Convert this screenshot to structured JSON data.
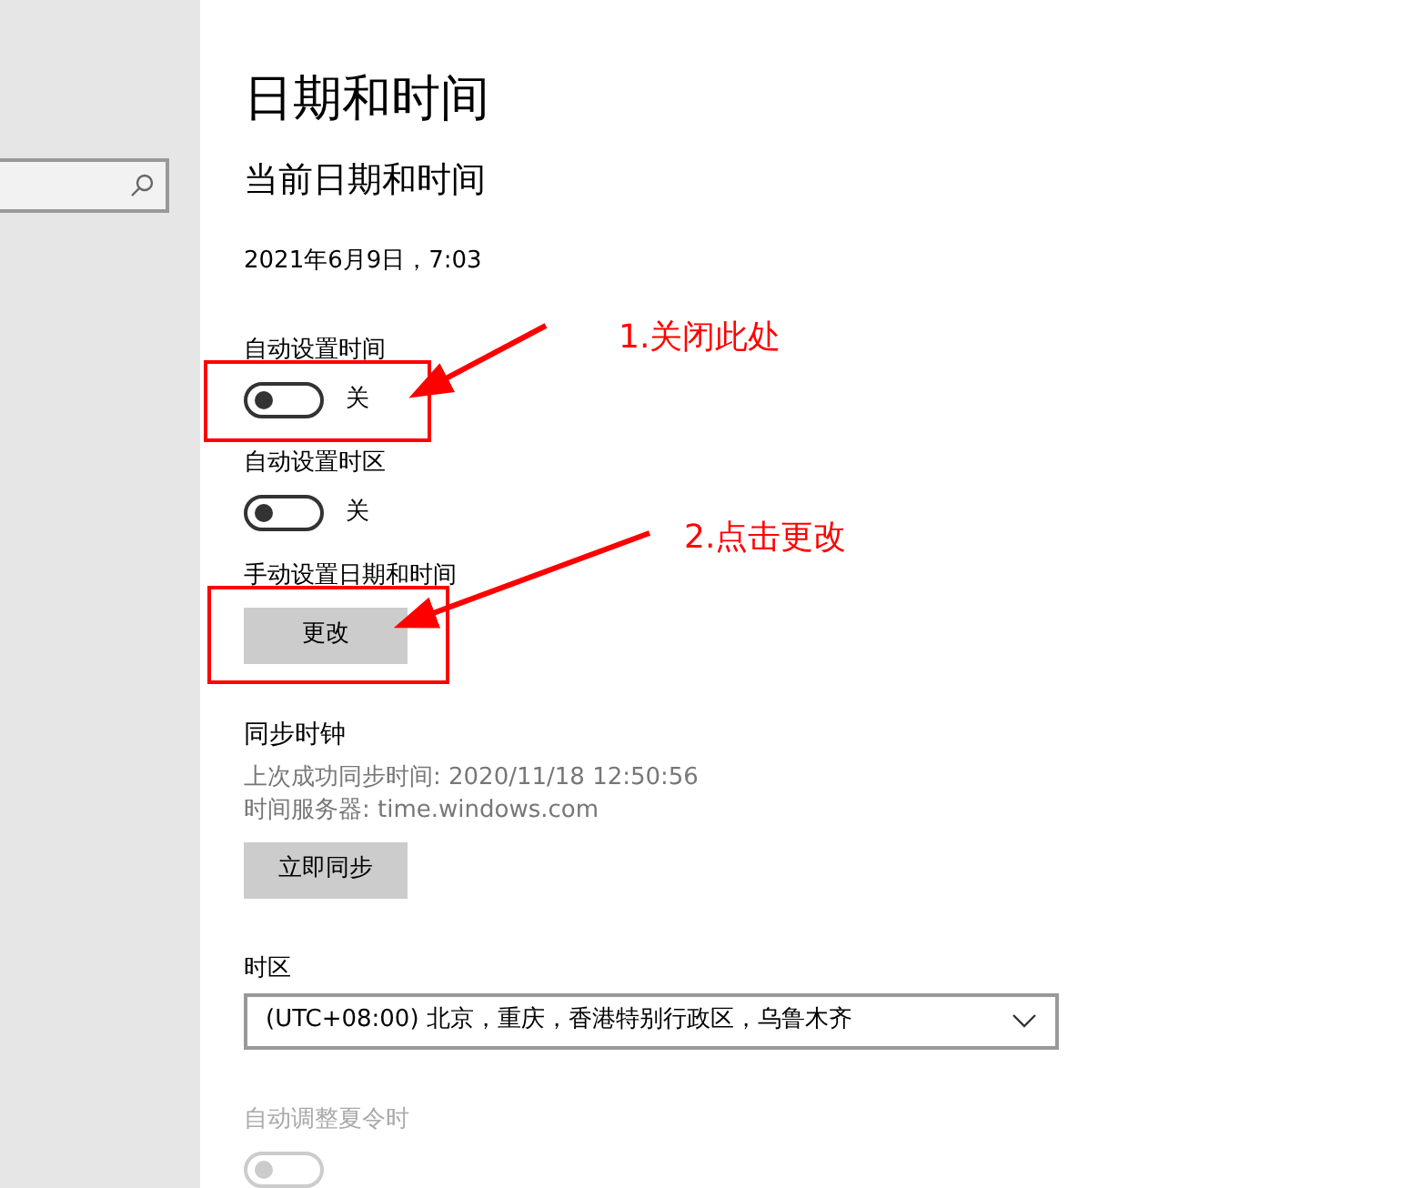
{
  "page": {
    "title": "日期和时间",
    "section": "当前日期和时间",
    "current": "2021年6月9日，7:03"
  },
  "settings": [
    {
      "kind": "toggle",
      "label": "自动设置时间",
      "on": false,
      "state_text": "关"
    },
    {
      "kind": "toggle",
      "label": "自动设置时区",
      "on": false,
      "state_text": "关"
    },
    {
      "kind": "button",
      "label": "手动设置日期和时间",
      "button": "更改"
    }
  ],
  "sync": {
    "title": "同步时钟",
    "lines": [
      "上次成功同步时间: 2020/11/18 12:50:56",
      "时间服务器: time.windows.com"
    ],
    "button": "立即同步"
  },
  "timezone": {
    "label": "时区",
    "value": "(UTC+08:00) 北京，重庆，香港特别行政区，乌鲁木齐"
  },
  "dst": {
    "label": "自动调整夏令时",
    "disabled": true,
    "on": false
  },
  "annotations": [
    "1.关闭此处",
    "2.点击更改"
  ]
}
